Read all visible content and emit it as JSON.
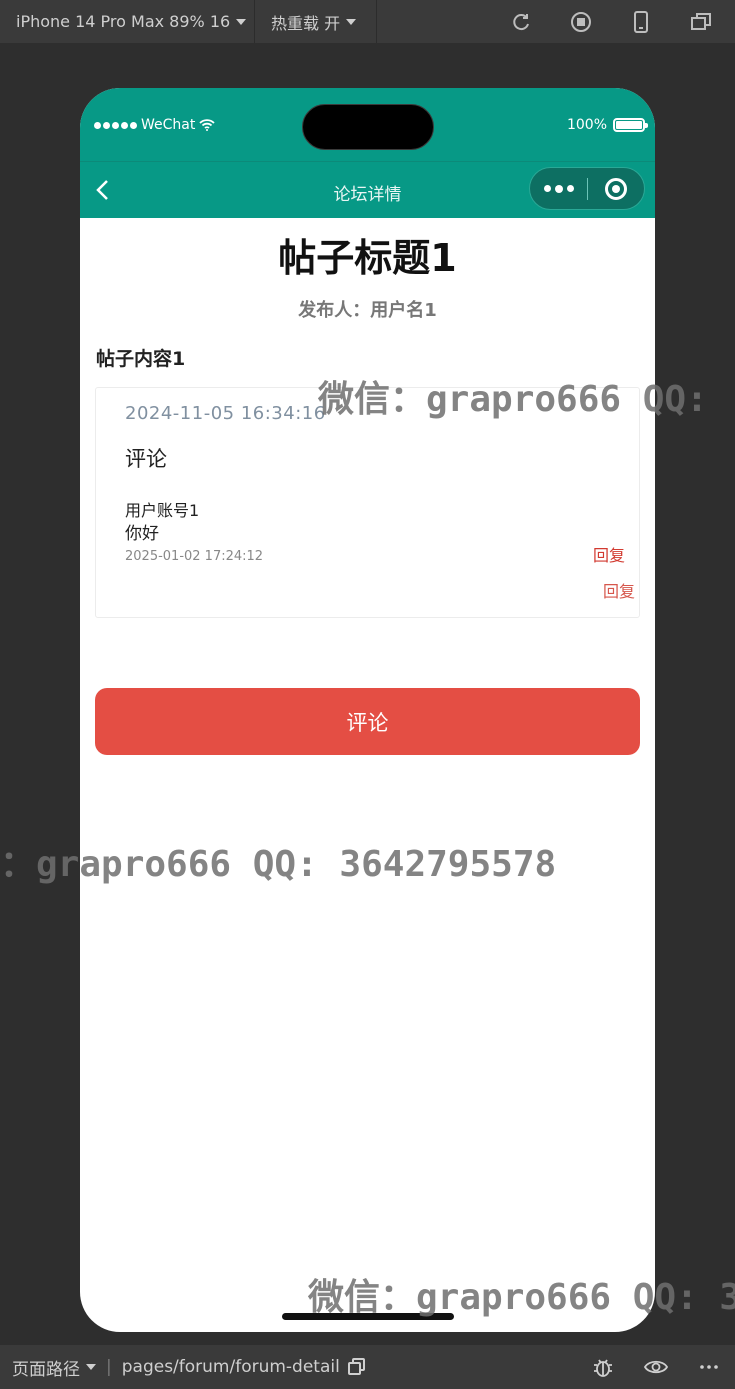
{
  "toolbar": {
    "device": "iPhone 14 Pro Max 89% 16",
    "hot_reload": "热重载 开"
  },
  "status_bar": {
    "carrier": "WeChat",
    "battery": "100%"
  },
  "nav": {
    "title": "论坛详情"
  },
  "post": {
    "title": "帖子标题1",
    "author_label": "发布人：",
    "author_name": "用户名1",
    "content": "帖子内容1"
  },
  "card": {
    "time": "2024-11-05 16:34:16",
    "section_title": "评论",
    "comments": [
      {
        "user": "用户账号1",
        "text": "你好",
        "time": "2025-01-02 17:24:12",
        "reply_label": "回复"
      }
    ],
    "reply_label": "回复"
  },
  "comment_button": "评论",
  "watermark": {
    "text1": "微信：grapro666 QQ:",
    "text2": "：grapro666 QQ: 3642795578",
    "text3": "微信：grapro666 QQ: 3"
  },
  "bottom_bar": {
    "path_label": "页面路径",
    "path": "pages/forum/forum-detail"
  },
  "colors": {
    "nav_bg": "#079986",
    "button_bg": "#e44e44",
    "reply_text": "#d23a30"
  }
}
